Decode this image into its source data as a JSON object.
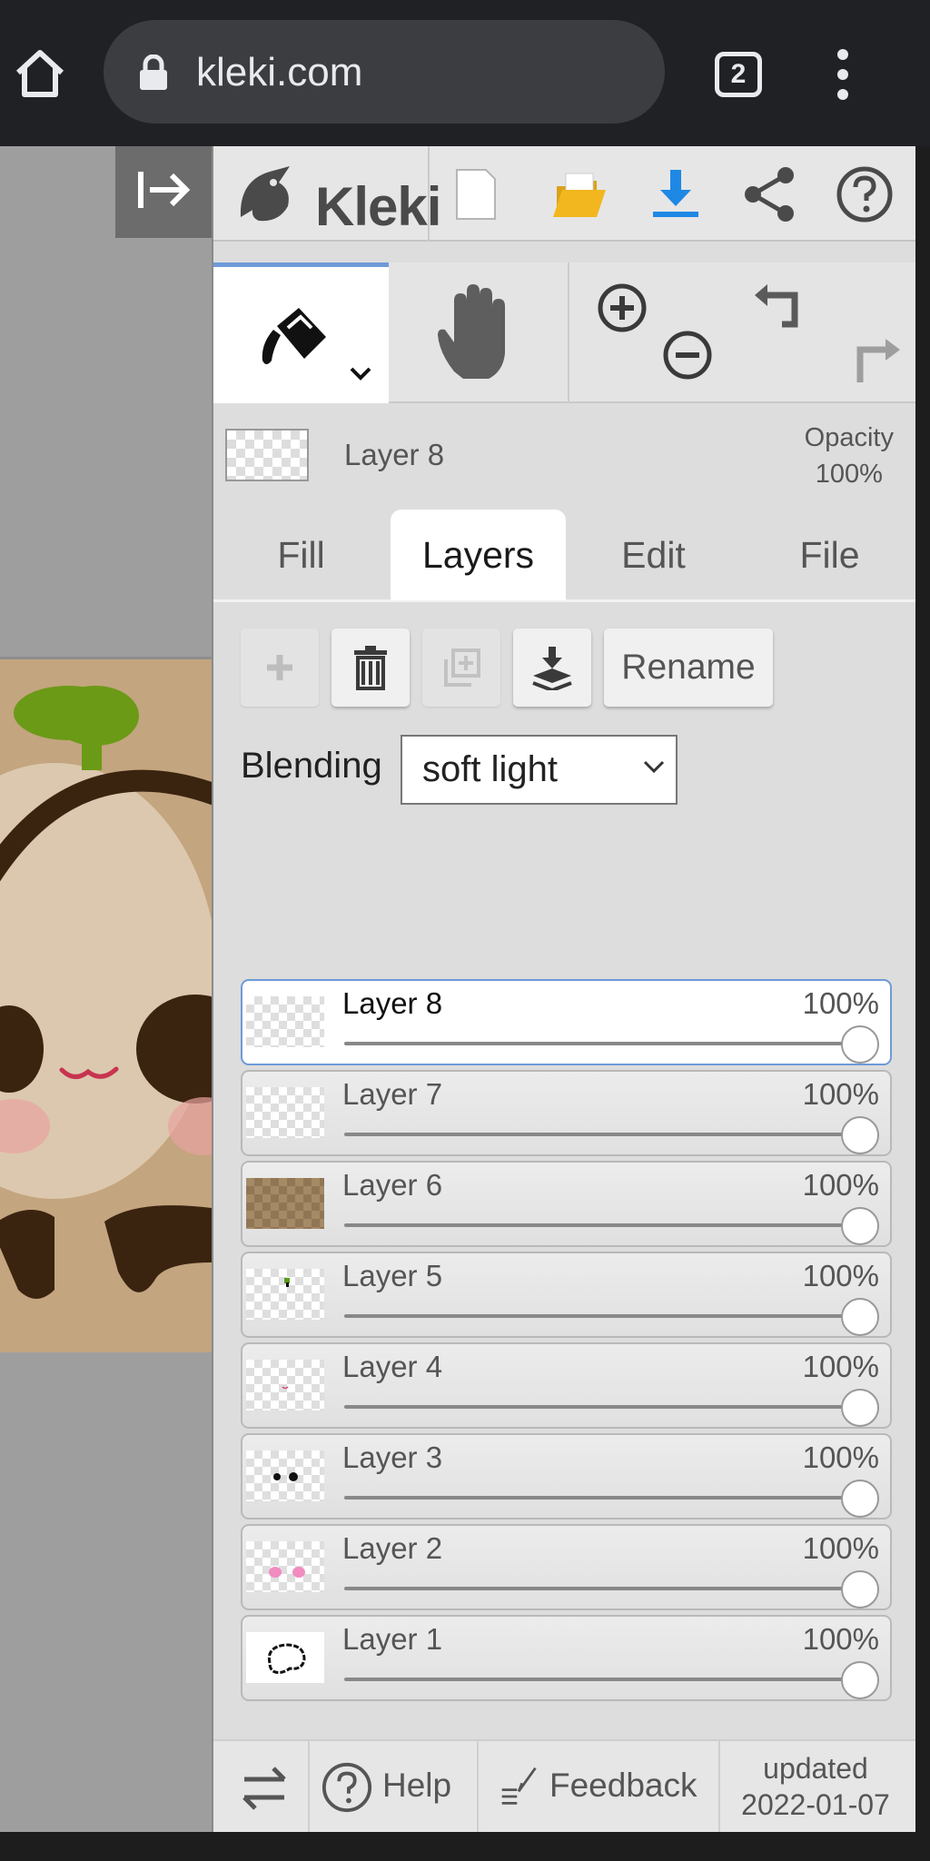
{
  "browser": {
    "url": "kleki.com",
    "tab_count": "2"
  },
  "app": {
    "name": "Kleki"
  },
  "layer_info": {
    "name": "Layer 8",
    "opacity_label": "Opacity",
    "opacity_value": "100%"
  },
  "tabs": [
    {
      "label": "Fill",
      "active": false
    },
    {
      "label": "Layers",
      "active": true
    },
    {
      "label": "Edit",
      "active": false
    },
    {
      "label": "File",
      "active": false
    }
  ],
  "layer_tools": {
    "rename_label": "Rename"
  },
  "blending": {
    "label": "Blending",
    "mode": "soft light"
  },
  "layers": [
    {
      "name": "Layer 8",
      "opacity": "100%",
      "active": true
    },
    {
      "name": "Layer 7",
      "opacity": "100%",
      "active": false
    },
    {
      "name": "Layer 6",
      "opacity": "100%",
      "active": false
    },
    {
      "name": "Layer 5",
      "opacity": "100%",
      "active": false
    },
    {
      "name": "Layer 4",
      "opacity": "100%",
      "active": false
    },
    {
      "name": "Layer 3",
      "opacity": "100%",
      "active": false
    },
    {
      "name": "Layer 2",
      "opacity": "100%",
      "active": false
    },
    {
      "name": "Layer 1",
      "opacity": "100%",
      "active": false
    }
  ],
  "footer": {
    "help_label": "Help",
    "feedback_label": "Feedback",
    "updated_label": "updated",
    "updated_date": "2022-01-07"
  },
  "colors": {
    "accent": "#6e9ad8",
    "download": "#1e88e5",
    "folder": "#f2b71f",
    "panel_bg": "#dddddd"
  }
}
